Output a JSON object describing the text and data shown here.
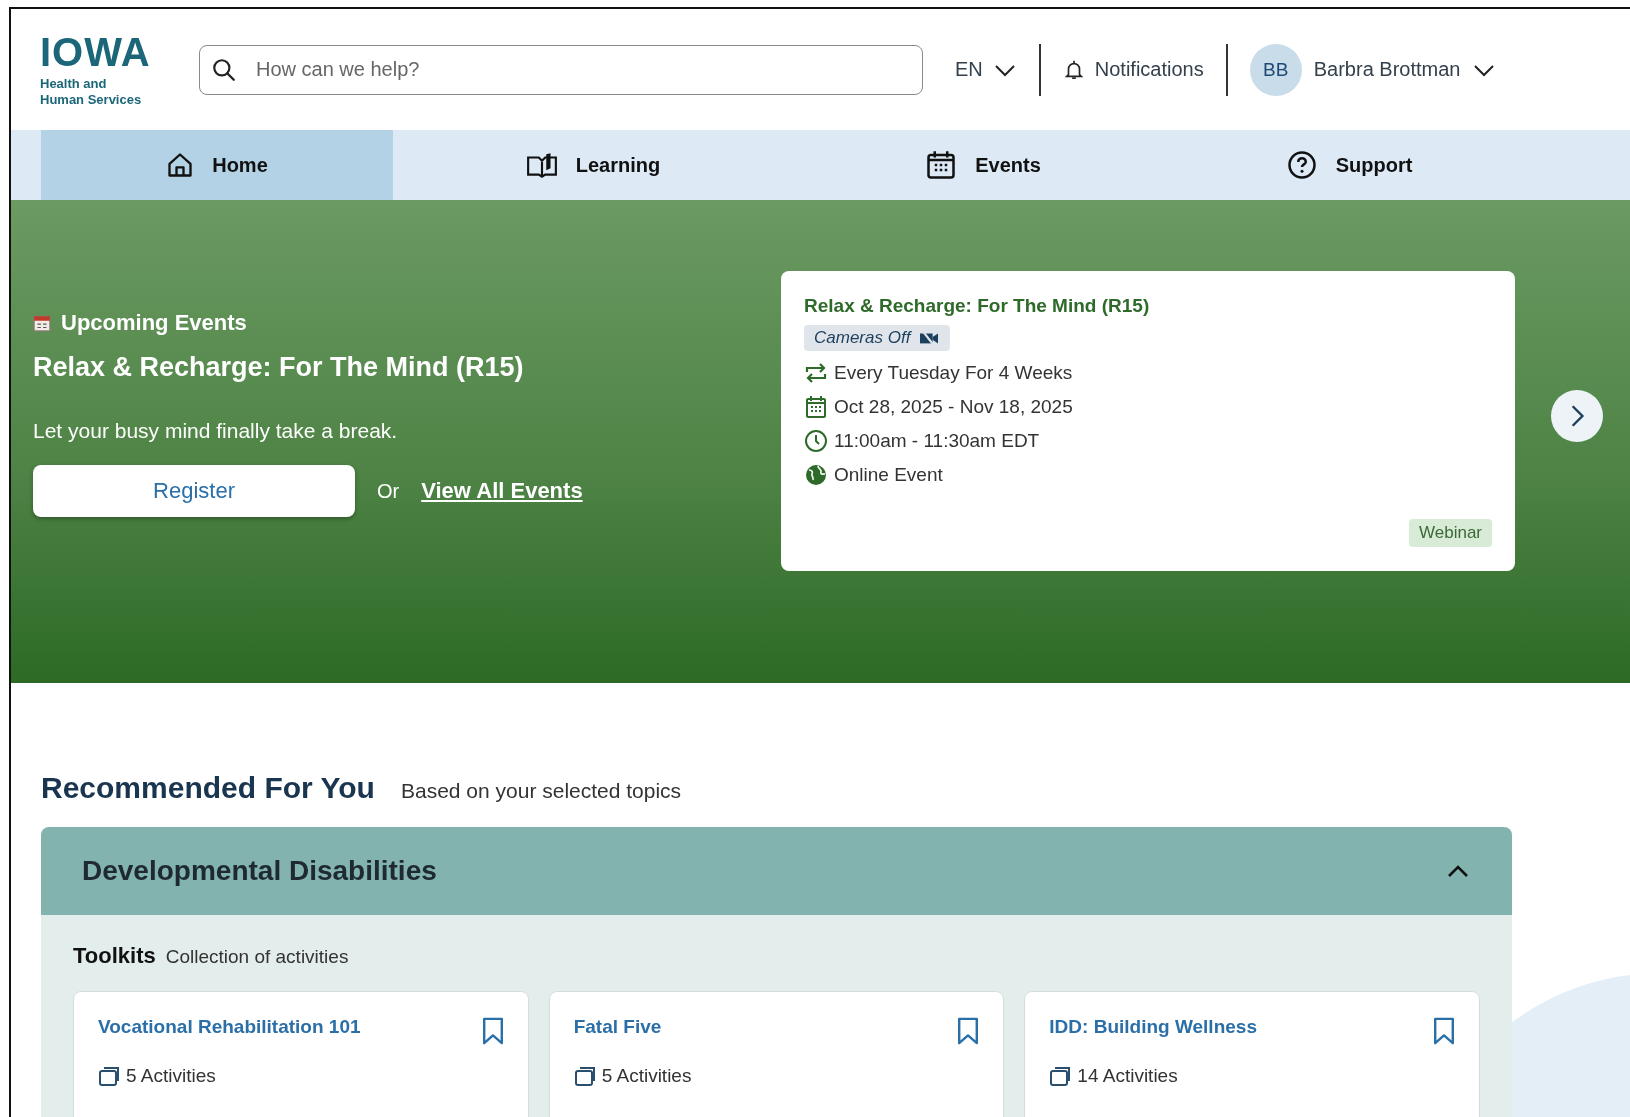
{
  "header": {
    "logo": {
      "wordmark": "IOWA",
      "subtitle": "Health and\nHuman Services"
    },
    "search": {
      "placeholder": "How can we help?"
    },
    "language": "EN",
    "notifications": "Notifications",
    "user": {
      "initials": "BB",
      "name": "Barbra Brottman"
    }
  },
  "nav": {
    "tabs": [
      {
        "label": "Home",
        "kind": "home",
        "selected": true
      },
      {
        "label": "Learning",
        "kind": "book",
        "selected": false
      },
      {
        "label": "Events",
        "kind": "calendar",
        "selected": false
      },
      {
        "label": "Support",
        "kind": "help",
        "selected": false
      }
    ]
  },
  "hero": {
    "section_label": "Upcoming Events",
    "title": "Relax & Recharge: For The Mind (R15)",
    "description": "Let your busy mind finally take a break.",
    "register_button": "Register",
    "or_text": "Or",
    "view_all_link": "View All Events",
    "event_card": {
      "title": "Relax & Recharge: For The Mind (R15)",
      "badge": "Cameras Off",
      "details": [
        {
          "kind": "repeat",
          "text": "Every Tuesday For 4 Weeks"
        },
        {
          "kind": "calendar",
          "text": "Oct 28, 2025 - Nov 18, 2025"
        },
        {
          "kind": "clock",
          "text": "11:00am - 11:30am EDT"
        },
        {
          "kind": "globe",
          "text": "Online Event"
        }
      ],
      "tag": "Webinar"
    }
  },
  "recommended": {
    "title": "Recommended For You",
    "subtitle": "Based on your selected topics",
    "topic": {
      "title": "Developmental Disabilities",
      "expanded": true,
      "section_title": "Toolkits",
      "section_subtitle": "Collection of activities",
      "cards": [
        {
          "title": "Vocational Rehabilitation 101",
          "activities": "5 Activities"
        },
        {
          "title": "Fatal Five",
          "activities": "5 Activities"
        },
        {
          "title": "IDD: Building Wellness",
          "activities": "14 Activities"
        }
      ]
    }
  }
}
